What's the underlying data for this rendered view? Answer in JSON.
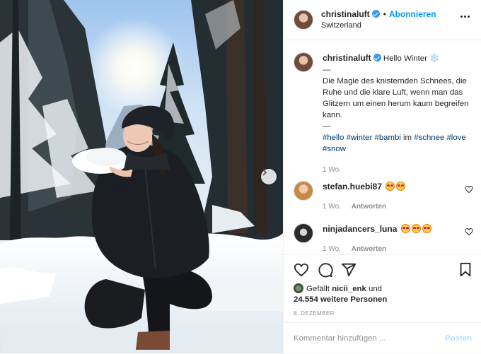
{
  "header": {
    "username": "christinaluft",
    "separator": "•",
    "follow_label": "Abonnieren",
    "location": "Switzerland"
  },
  "caption": {
    "username": "christinaluft",
    "title": "Hello Winter",
    "title_emoji": "❄️",
    "dash1": "—",
    "text": "Die Magie des knisternden Schnees, die Ruhe und die klare Luft, wenn man das Glitzern um einen herum kaum begreifen kann.",
    "dash2": "—",
    "hashtags": [
      "#hello",
      "#winter",
      "#bambi",
      "im",
      "#schnee",
      "#love",
      "#snow"
    ],
    "time": "1 Wo."
  },
  "comments": [
    {
      "username": "stefan.huebi87",
      "emoji_count": 2,
      "time": "1 Wo.",
      "reply_label": "Antworten"
    },
    {
      "username": "ninjadancers_luna",
      "emoji_count": 3,
      "time": "1 Wo.",
      "reply_label": "Antworten"
    }
  ],
  "likes": {
    "prefix": "Gefällt",
    "user": "nicii_enk",
    "conjunction": "und",
    "count": "24.554 weitere Personen"
  },
  "date": "8. DEZEMBER",
  "composer": {
    "placeholder": "Kommentar hinzufügen ...",
    "post_label": "Posten"
  },
  "icons": [
    "heart-icon",
    "comment-icon",
    "share-icon",
    "bookmark-icon",
    "more-icon",
    "verified-icon",
    "snowflake-icon",
    "chevron-right-icon"
  ],
  "colors": {
    "accent": "#0095f6",
    "hashtag": "#00376b",
    "muted": "#8e8e8e",
    "post_disabled": "#b2dffc"
  }
}
